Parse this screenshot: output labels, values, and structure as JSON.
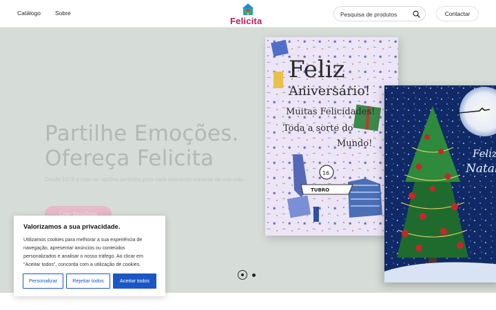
{
  "header": {
    "nav": [
      {
        "label": "Catálogo"
      },
      {
        "label": "Sobre"
      }
    ],
    "logo_text": "Felicita",
    "search": {
      "placeholder": "Pesquisa de produtos",
      "icon": "search-icon"
    },
    "contact_label": "Contactar"
  },
  "hero": {
    "title_line1": "Partilhe Emoções.",
    "title_line2": "Ofereça Felicita",
    "subtitle": "Desde 1978 a criar os cartões perfeitos para cada momento especial da sua vida.",
    "cta_label": "Criar Beneficiar",
    "card1_lines": [
      "Feliz",
      "Aniversário!",
      "Muitas Felicidades!",
      "Toda a sorte do",
      "Mundo!"
    ],
    "card1_tag": "16",
    "card1_shirt": "TUBRO",
    "card2_lines": [
      "Feliz",
      "Natal"
    ],
    "carousel": {
      "slides": 2,
      "active": 1
    }
  },
  "cookie": {
    "title": "Valorizamos a sua privacidade.",
    "text": "Utilizamos cookies para melhorar a sua experiência de navegação, apresentar anúncios ou conteúdos personalizados e analisar o nosso tráfego. Ao clicar em \"Aceitar todos\", concorda com a utilização de cookies.",
    "customize_label": "Personalizar",
    "reject_label": "Rejeitar todos",
    "accept_label": "Aceitar todos"
  },
  "colors": {
    "brand": "#c2185b",
    "accent_blue": "#1a56c6",
    "hero_bg": "#d6dcd7"
  }
}
